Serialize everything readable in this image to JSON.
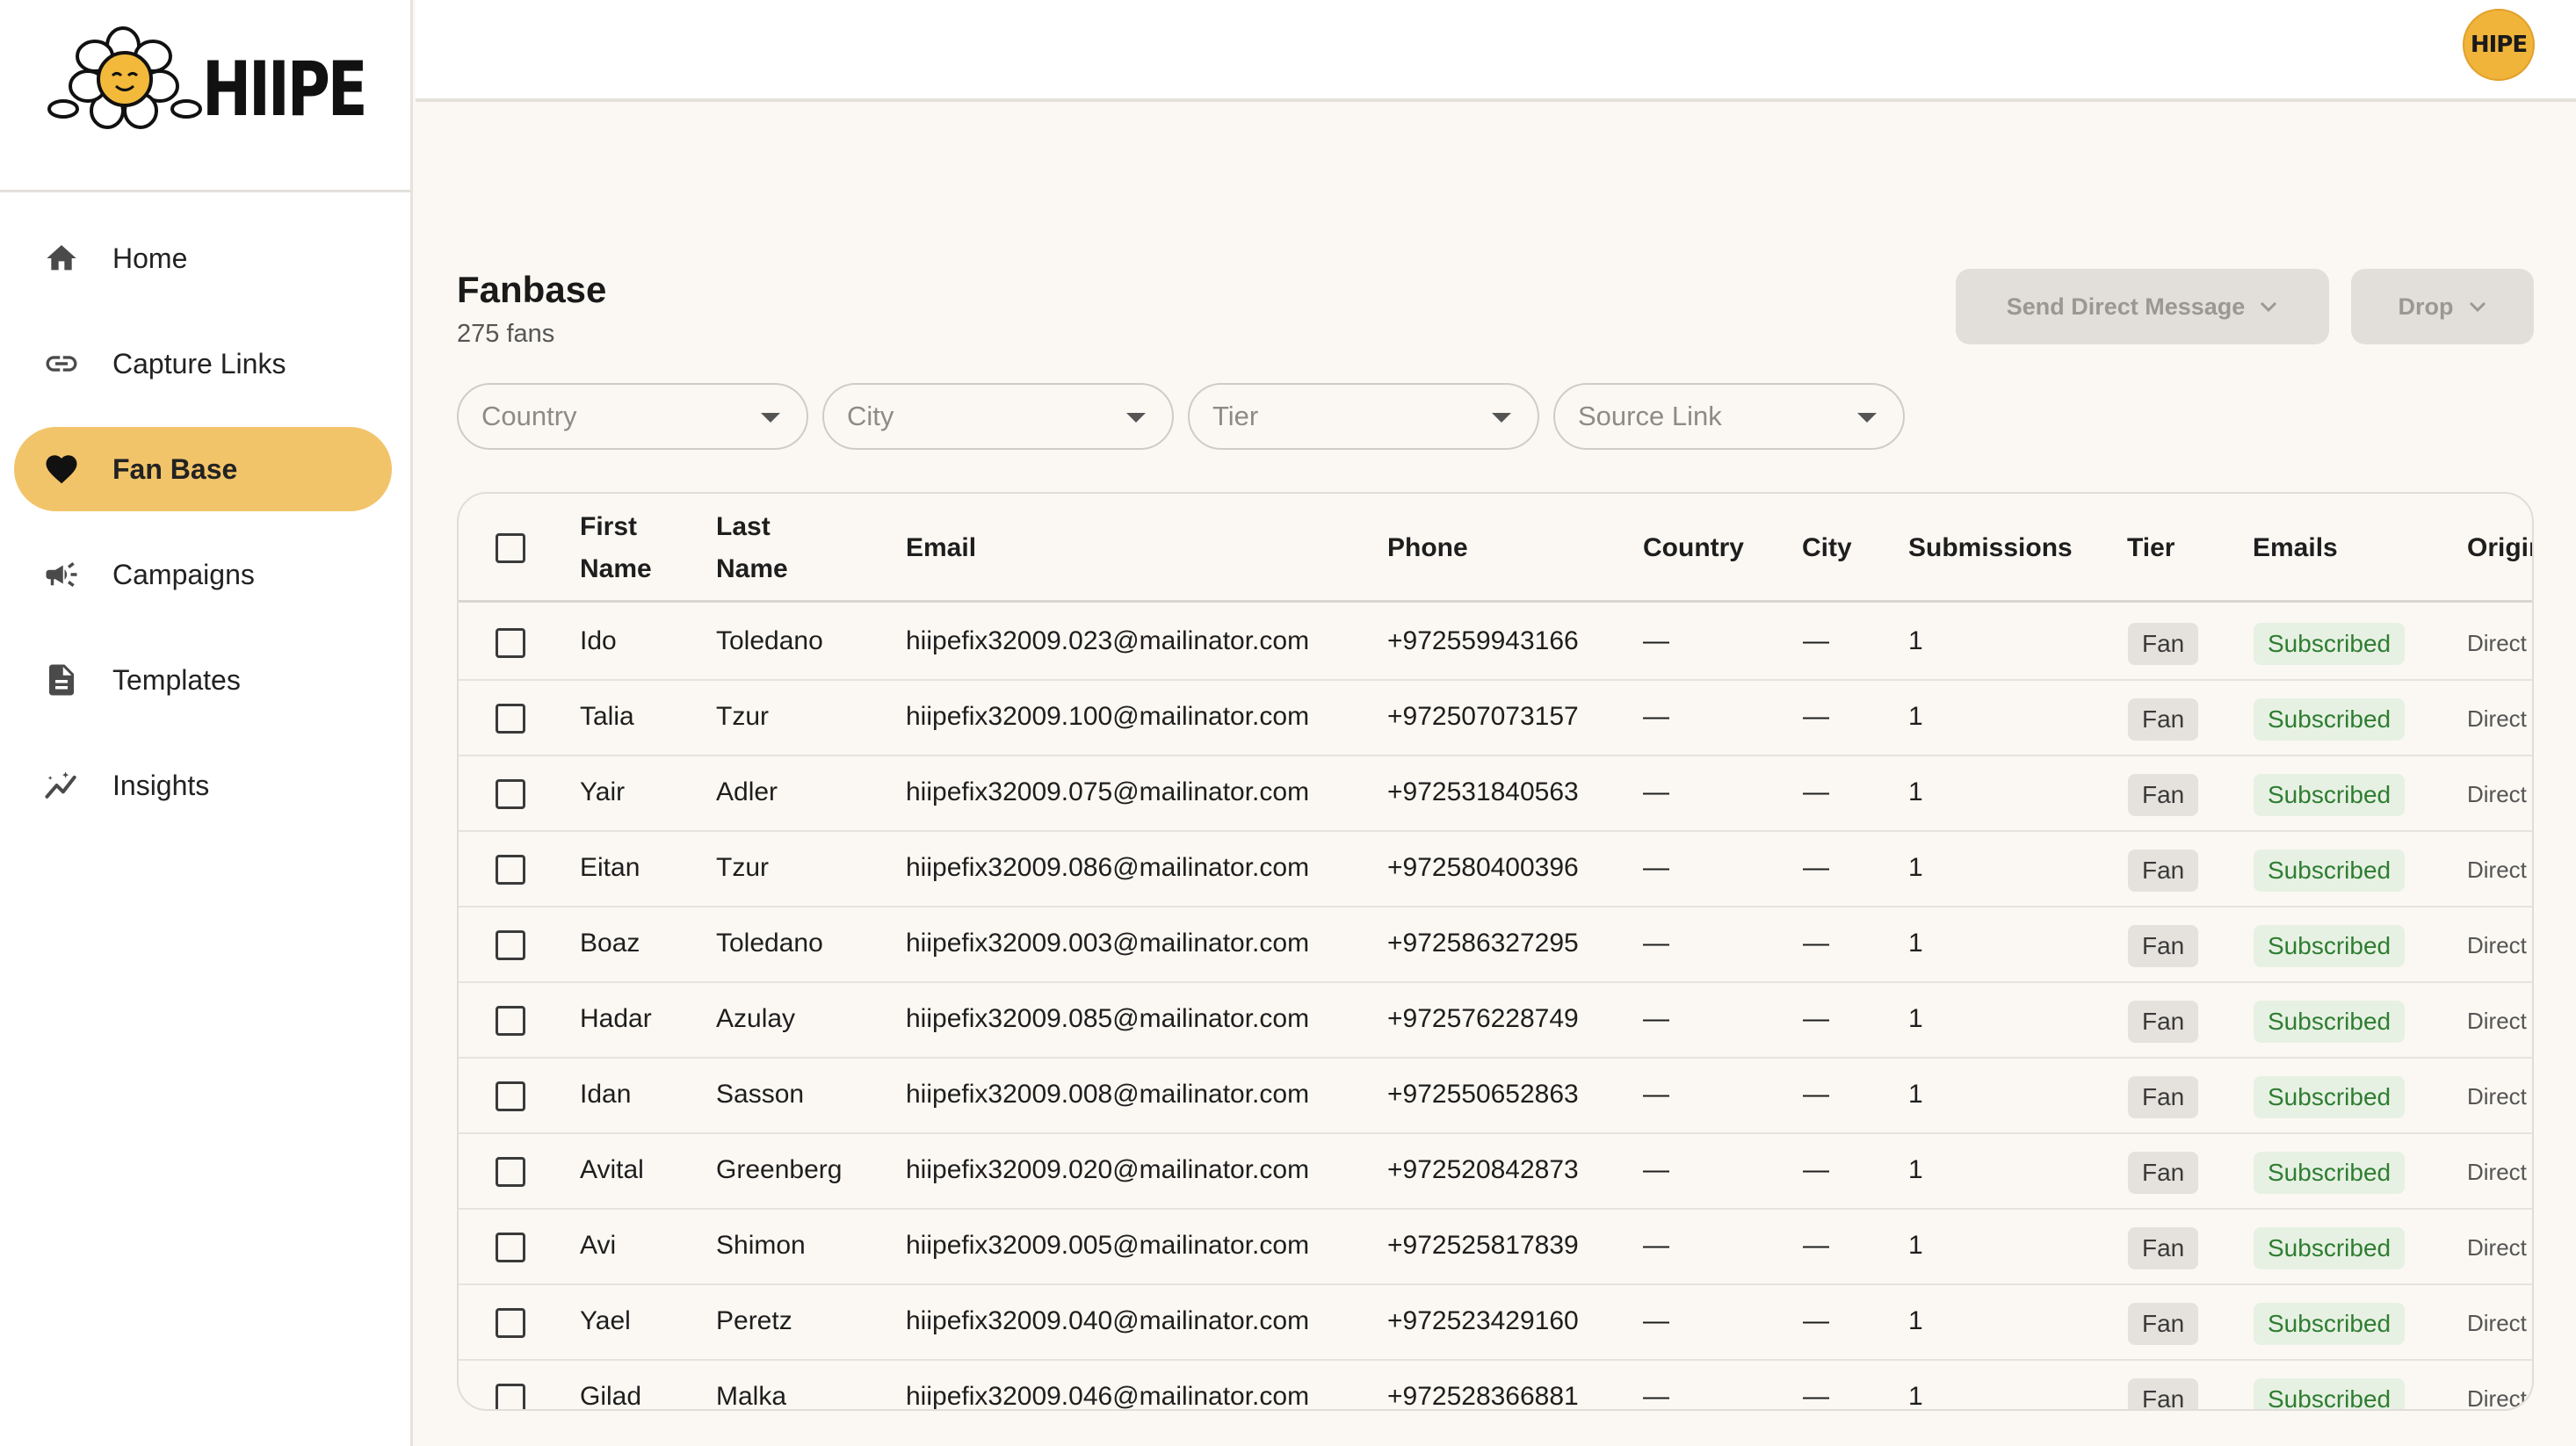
{
  "brand": {
    "name": "HIIPE",
    "avatar_text": "HIPE"
  },
  "sidebar": {
    "items": [
      {
        "label": "Home",
        "icon": "home-icon"
      },
      {
        "label": "Capture Links",
        "icon": "link-icon"
      },
      {
        "label": "Fan Base",
        "icon": "heart-icon",
        "active": true
      },
      {
        "label": "Campaigns",
        "icon": "megaphone-icon"
      },
      {
        "label": "Templates",
        "icon": "document-icon"
      },
      {
        "label": "Insights",
        "icon": "insights-icon"
      }
    ]
  },
  "header": {
    "title": "Fanbase",
    "count": "275 fans",
    "send_dm_label": "Send Direct Message",
    "drop_label": "Drop"
  },
  "filters": {
    "country": "Country",
    "city": "City",
    "tier": "Tier",
    "source": "Source Link"
  },
  "table": {
    "headers": {
      "first_name_1": "First",
      "first_name_2": "Name",
      "last_name_1": "Last",
      "last_name_2": "Name",
      "email": "Email",
      "phone": "Phone",
      "country": "Country",
      "city": "City",
      "submissions": "Submissions",
      "tier": "Tier",
      "emails": "Emails",
      "origin": "Origin"
    },
    "rows": [
      {
        "first": "Ido",
        "last": "Toledano",
        "email": "hiipefix32009.023@mailinator.com",
        "phone": "+972559943166",
        "country": "—",
        "city": "—",
        "submissions": "1",
        "tier": "Fan",
        "emails": "Subscribed",
        "origin": "Direct"
      },
      {
        "first": "Talia",
        "last": "Tzur",
        "email": "hiipefix32009.100@mailinator.com",
        "phone": "+972507073157",
        "country": "—",
        "city": "—",
        "submissions": "1",
        "tier": "Fan",
        "emails": "Subscribed",
        "origin": "Direct"
      },
      {
        "first": "Yair",
        "last": "Adler",
        "email": "hiipefix32009.075@mailinator.com",
        "phone": "+972531840563",
        "country": "—",
        "city": "—",
        "submissions": "1",
        "tier": "Fan",
        "emails": "Subscribed",
        "origin": "Direct"
      },
      {
        "first": "Eitan",
        "last": "Tzur",
        "email": "hiipefix32009.086@mailinator.com",
        "phone": "+972580400396",
        "country": "—",
        "city": "—",
        "submissions": "1",
        "tier": "Fan",
        "emails": "Subscribed",
        "origin": "Direct"
      },
      {
        "first": "Boaz",
        "last": "Toledano",
        "email": "hiipefix32009.003@mailinator.com",
        "phone": "+972586327295",
        "country": "—",
        "city": "—",
        "submissions": "1",
        "tier": "Fan",
        "emails": "Subscribed",
        "origin": "Direct"
      },
      {
        "first": "Hadar",
        "last": "Azulay",
        "email": "hiipefix32009.085@mailinator.com",
        "phone": "+972576228749",
        "country": "—",
        "city": "—",
        "submissions": "1",
        "tier": "Fan",
        "emails": "Subscribed",
        "origin": "Direct"
      },
      {
        "first": "Idan",
        "last": "Sasson",
        "email": "hiipefix32009.008@mailinator.com",
        "phone": "+972550652863",
        "country": "—",
        "city": "—",
        "submissions": "1",
        "tier": "Fan",
        "emails": "Subscribed",
        "origin": "Direct"
      },
      {
        "first": "Avital",
        "last": "Greenberg",
        "email": "hiipefix32009.020@mailinator.com",
        "phone": "+972520842873",
        "country": "—",
        "city": "—",
        "submissions": "1",
        "tier": "Fan",
        "emails": "Subscribed",
        "origin": "Direct"
      },
      {
        "first": "Avi",
        "last": "Shimon",
        "email": "hiipefix32009.005@mailinator.com",
        "phone": "+972525817839",
        "country": "—",
        "city": "—",
        "submissions": "1",
        "tier": "Fan",
        "emails": "Subscribed",
        "origin": "Direct"
      },
      {
        "first": "Yael",
        "last": "Peretz",
        "email": "hiipefix32009.040@mailinator.com",
        "phone": "+972523429160",
        "country": "—",
        "city": "—",
        "submissions": "1",
        "tier": "Fan",
        "emails": "Subscribed",
        "origin": "Direct"
      },
      {
        "first": "Gilad",
        "last": "Malka",
        "email": "hiipefix32009.046@mailinator.com",
        "phone": "+972528366881",
        "country": "—",
        "city": "—",
        "submissions": "1",
        "tier": "Fan",
        "emails": "Subscribed",
        "origin": "Direct"
      }
    ]
  },
  "colors": {
    "accent": "#F2C46A",
    "background": "#FBF8F3",
    "subscribed_bg": "#E7F1E3",
    "subscribed_text": "#2E7D32",
    "disabled_button": "#E2DFDA"
  }
}
